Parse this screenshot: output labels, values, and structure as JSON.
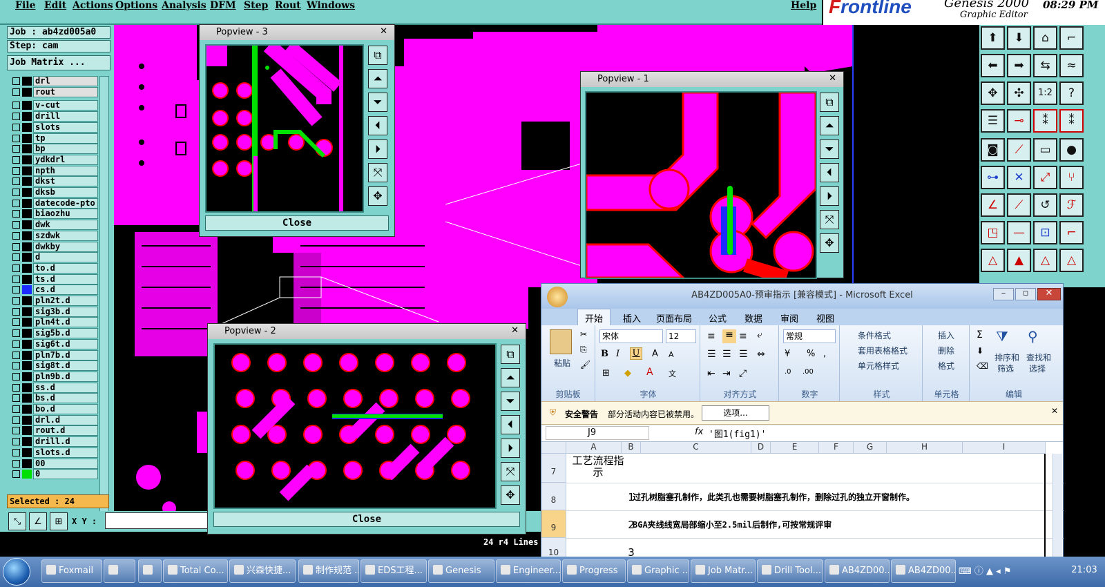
{
  "menu": {
    "items": [
      "File",
      "Edit",
      "Actions",
      "Options",
      "Analysis",
      "DFM",
      "Step",
      "Rout",
      "Windows"
    ],
    "help": "Help"
  },
  "brand": {
    "logo_f": "F",
    "logo_rest": "rontline",
    "product": "Genesis 2000",
    "subtitle": "Graphic Editor",
    "time": "08:29 PM"
  },
  "job": {
    "job": "Job : ab4zd005a0",
    "step": "Step: cam",
    "matrix": "Job Matrix ..."
  },
  "layers": [
    "drl",
    "rout",
    "v-cut",
    "drill",
    "slots",
    "tp",
    "bp",
    "ydkdrl",
    "npth",
    "dkst",
    "dksb",
    "datecode-pto",
    "biaozhu",
    "dwk",
    "szdwk",
    "dwkby",
    "d",
    "to.d",
    "ts.d",
    "cs.d",
    "pln2t.d",
    "sig3b.d",
    "pln4t.d",
    "sig5b.d",
    "sig6t.d",
    "pln7b.d",
    "sig8t.d",
    "pln9b.d",
    "ss.d",
    "bs.d",
    "bo.d",
    "drl.d",
    "rout.d",
    "drill.d",
    "slots.d",
    "00",
    "0"
  ],
  "selected": "Selected : 24",
  "xy_label": "X Y :",
  "status": "24 r4 Lines",
  "popups": {
    "p3": {
      "title": "Popview - 3",
      "close": "Close"
    },
    "p1": {
      "title": "Popview - 1"
    },
    "p2": {
      "title": "Popview - 2",
      "close": "Close"
    }
  },
  "excel": {
    "title": "AB4ZD005A0-预审指示 [兼容模式] - Microsoft Excel",
    "tabs": [
      "开始",
      "插入",
      "页面布局",
      "公式",
      "数据",
      "审阅",
      "视图"
    ],
    "clipboard": {
      "paste": "粘贴",
      "label": "剪贴板"
    },
    "font": {
      "name": "宋体",
      "size": "12",
      "label": "字体"
    },
    "align": {
      "label": "对齐方式"
    },
    "number": {
      "format": "常规",
      "label": "数字"
    },
    "styles": {
      "cond": "条件格式",
      "table": "套用表格格式",
      "cell": "单元格样式",
      "label": "样式"
    },
    "cells": {
      "insert": "插入",
      "delete": "删除",
      "format": "格式",
      "label": "单元格"
    },
    "edit": {
      "sort": "排序和",
      "sort2": "筛选",
      "find": "查找和",
      "find2": "选择",
      "label": "编辑"
    },
    "security": {
      "title": "安全警告",
      "msg": "部分活动内容已被禁用。",
      "btn": "选项..."
    },
    "namebox": "J9",
    "formula": "'图1(fig1)'",
    "columns": [
      "A",
      "B",
      "C",
      "D",
      "E",
      "F",
      "G",
      "H",
      "I"
    ],
    "rows": [
      {
        "num": "7",
        "a": "工艺流程指示",
        "b": "",
        "c": ""
      },
      {
        "num": "8",
        "a": "",
        "b": "1",
        "c": "过孔树脂塞孔制作，此类孔也需要树脂塞孔制作，删除过孔的独立开窗制作。"
      },
      {
        "num": "9",
        "a": "",
        "b": "2",
        "c": "BGA夹线线宽局部缩小至2.5mil后制作,可按常规评审"
      },
      {
        "num": "10",
        "a": "",
        "b": "3",
        "c": ""
      }
    ]
  },
  "taskbar": {
    "items": [
      "Foxmail",
      "",
      "",
      "Total Co...",
      "兴森快捷...",
      "制作规范 ...",
      "EDS工程...",
      "Genesis",
      "Engineer...",
      "Progress",
      "Graphic ...",
      "Job Matr...",
      "Drill Tool...",
      "AB4ZD00...",
      "AB4ZD00..."
    ],
    "clock": "21:03"
  },
  "colors": {
    "panel": "#7fd3cd",
    "copper": "#ff00ff",
    "outline": "#ff0000",
    "highlight": "#00e000"
  }
}
